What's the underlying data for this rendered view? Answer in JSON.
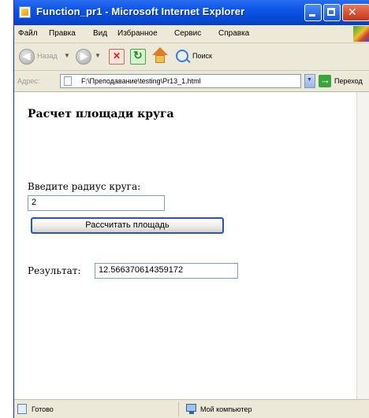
{
  "window": {
    "title": "Function_pr1 - Microsoft Internet Explorer"
  },
  "menu": {
    "items": [
      "Файл",
      "Правка",
      "Вид",
      "Избранное",
      "Сервис",
      "Справка"
    ]
  },
  "toolbar": {
    "back_label": "Назад",
    "search_label": "Поиск"
  },
  "address": {
    "label": "Адрес:",
    "url": "F:\\Преподавание\\testing\\Pr13_1.html",
    "go_label": "Переход"
  },
  "page": {
    "title": "Расчет площади круга",
    "radius_label": "Введите радиус круга:",
    "radius_value": "2",
    "button_label": "Рассчитать площадь",
    "result_label": "Результат:",
    "result_value": "12.566370614359172"
  },
  "status": {
    "text": "Готово",
    "zone": "Мой компьютер"
  }
}
